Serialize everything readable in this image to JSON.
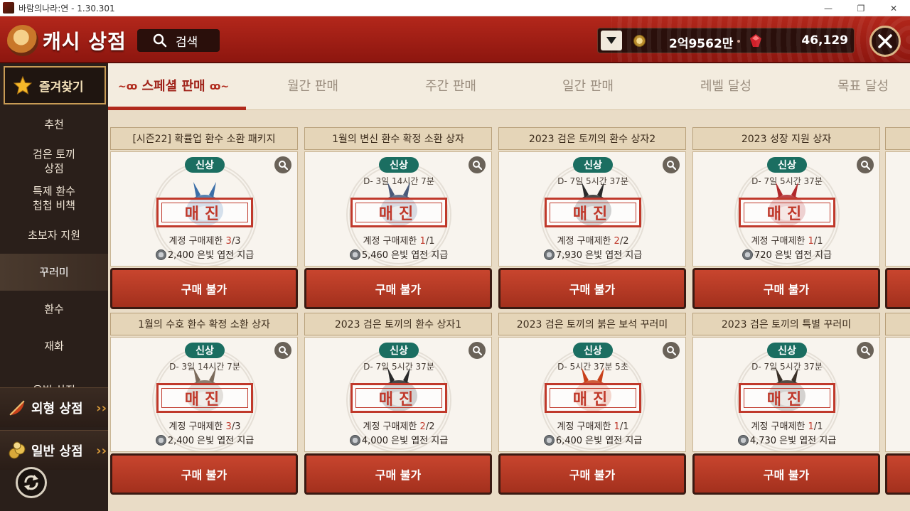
{
  "window": {
    "title": "바람의나라:연 - 1.30.301",
    "buttons": [
      "—",
      "❐",
      "✕"
    ]
  },
  "header": {
    "title": "캐시 상점",
    "search_label": "검색",
    "currency_gold": "2억9562만",
    "currency_cash": "46,129"
  },
  "sidebar": {
    "favorites": "즐겨찾기",
    "items": [
      {
        "label": "추천",
        "active": false
      },
      {
        "label": "검은 토끼\n상점",
        "active": false
      },
      {
        "label": "특제 환수\n첩첩 비책",
        "active": false
      },
      {
        "label": "초보자 지원",
        "active": false
      },
      {
        "label": "꾸러미",
        "active": true
      },
      {
        "label": "환수",
        "active": false
      },
      {
        "label": "재화",
        "active": false
      },
      {
        "label": "은빛 상점",
        "active": false
      }
    ],
    "sections": [
      {
        "label": "외형 상점",
        "icon": "fan-icon"
      },
      {
        "label": "일반 상점",
        "icon": "coins-icon"
      }
    ]
  },
  "tabs": [
    {
      "label": "스페셜 판매",
      "active": true
    },
    {
      "label": "월간 판매",
      "active": false
    },
    {
      "label": "주간 판매",
      "active": false
    },
    {
      "label": "일간 판매",
      "active": false
    },
    {
      "label": "레벨 달성",
      "active": false
    },
    {
      "label": "목표 달성",
      "active": false
    }
  ],
  "products": [
    {
      "name": "[시즌22] 확률업 환수 소환 패키지",
      "badge": "신상",
      "timer": "",
      "soldout": "매진",
      "limit_label": "계정 구매제한",
      "limit_bought": "3",
      "limit_max": "/3",
      "reward": "2,400 은빛 엽전 지급",
      "button": "구매 불가",
      "art_color": "#3b6ea8"
    },
    {
      "name": "1월의 변신 환수 확정 소환 상자",
      "badge": "신상",
      "timer": "D- 3일 14시간 7분",
      "soldout": "매진",
      "limit_label": "계정 구매제한",
      "limit_bought": "1",
      "limit_max": "/1",
      "reward": "5,460 은빛 엽전 지급",
      "button": "구매 불가",
      "art_color": "#4a5a7a"
    },
    {
      "name": "2023 검은 토끼의 환수 상자2",
      "badge": "신상",
      "timer": "D- 7일 5시간 37분",
      "soldout": "매진",
      "limit_label": "계정 구매제한",
      "limit_bought": "2",
      "limit_max": "/2",
      "reward": "7,930 은빛 엽전 지급",
      "button": "구매 불가",
      "art_color": "#2a2a2a"
    },
    {
      "name": "2023 성장 지원 상자",
      "badge": "신상",
      "timer": "D- 7일 5시간 37분",
      "soldout": "매진",
      "limit_label": "계정 구매제한",
      "limit_bought": "1",
      "limit_max": "/1",
      "reward": "720 은빛 엽전 지급",
      "button": "구매 불가",
      "art_color": "#b0282a"
    },
    {
      "name": "1월의 수호 환수 확정 소환 상자",
      "badge": "신상",
      "timer": "D- 3일 14시간 7분",
      "soldout": "매진",
      "limit_label": "계정 구매제한",
      "limit_bought": "3",
      "limit_max": "/3",
      "reward": "2,400 은빛 엽전 지급",
      "button": "구매 불가",
      "art_color": "#7a6a5a"
    },
    {
      "name": "2023 검은 토끼의 환수 상자1",
      "badge": "신상",
      "timer": "D- 7일 5시간 37분",
      "soldout": "매진",
      "limit_label": "계정 구매제한",
      "limit_bought": "2",
      "limit_max": "/2",
      "reward": "4,000 은빛 엽전 지급",
      "button": "구매 불가",
      "art_color": "#2a2a2a"
    },
    {
      "name": "2023 검은 토끼의 붉은 보석 꾸러미",
      "badge": "신상",
      "timer": "D- 5시간 37분 5초",
      "soldout": "매진",
      "limit_label": "계정 구매제한",
      "limit_bought": "1",
      "limit_max": "/1",
      "reward": "6,400 은빛 엽전 지급",
      "button": "구매 불가",
      "art_color": "#c8401a"
    },
    {
      "name": "2023 검은 토끼의 특별 꾸러미",
      "badge": "신상",
      "timer": "D- 7일 5시간 37분",
      "soldout": "매진",
      "limit_label": "계정 구매제한",
      "limit_bought": "1",
      "limit_max": "/1",
      "reward": "4,730 은빛 엽전 지급",
      "button": "구매 불가",
      "art_color": "#3a3028"
    }
  ]
}
